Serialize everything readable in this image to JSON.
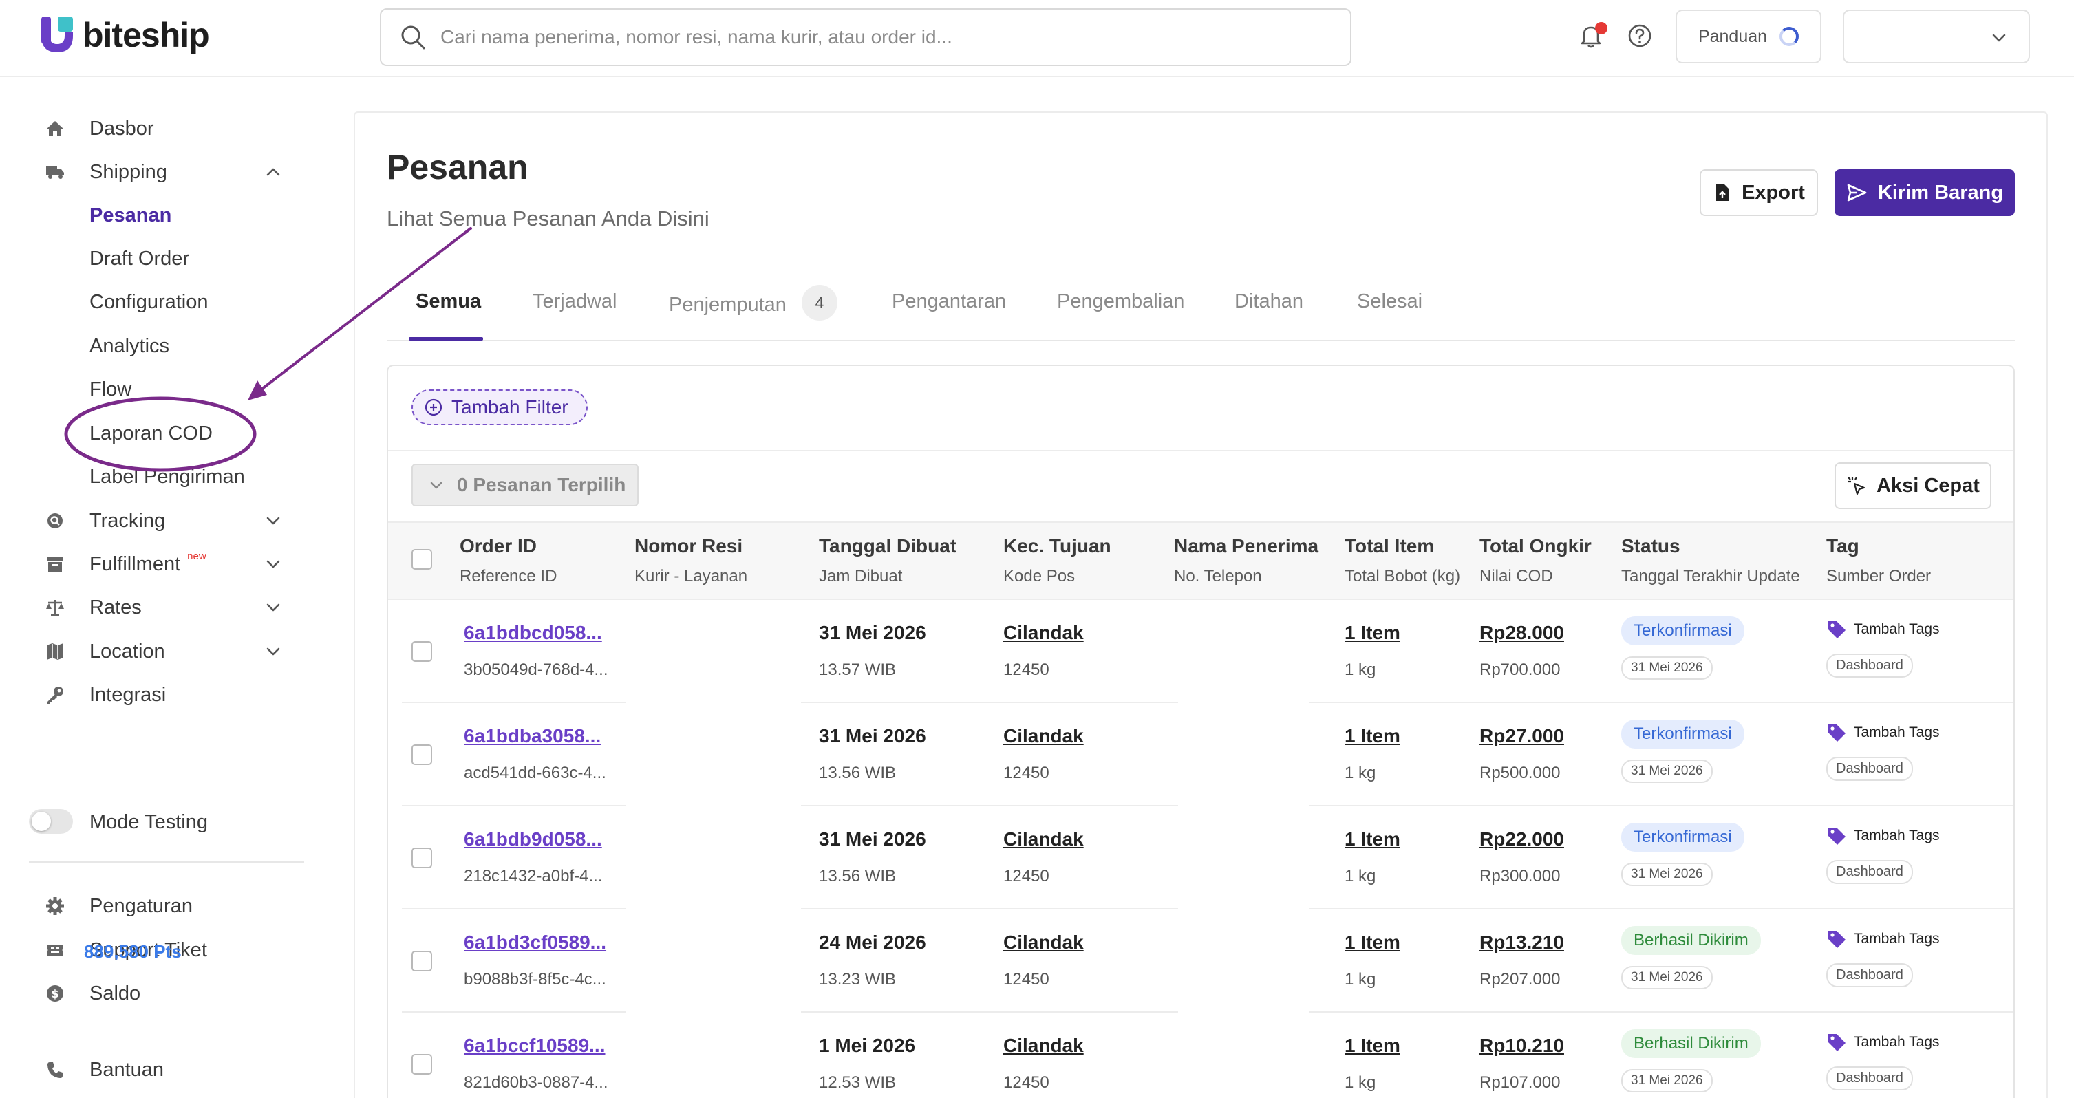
{
  "brand": {
    "name": "biteship",
    "accent": "#4b2ba3"
  },
  "search": {
    "placeholder": "Cari nama penerima, nomor resi, nama kurir, atau order id..."
  },
  "topbar": {
    "guide_label": "Panduan"
  },
  "sidebar": {
    "dashboard": "Dasbor",
    "shipping": "Shipping",
    "shipping_children": [
      "Pesanan",
      "Draft Order",
      "Configuration",
      "Analytics",
      "Flow",
      "Laporan COD",
      "Label Pengiriman"
    ],
    "tracking": "Tracking",
    "fulfillment": "Fulfillment",
    "fulfillment_badge": "new",
    "rates": "Rates",
    "location": "Location",
    "integration": "Integrasi",
    "mode_testing": "Mode Testing",
    "settings": "Pengaturan",
    "support": "Support Tiket",
    "balance": "Saldo",
    "balance_points": "889,580 Pts",
    "help": "Bantuan"
  },
  "page": {
    "title": "Pesanan",
    "subtitle": "Lihat Semua Pesanan Anda Disini",
    "export_label": "Export",
    "send_label": "Kirim Barang"
  },
  "tabs": [
    {
      "label": "Semua"
    },
    {
      "label": "Terjadwal"
    },
    {
      "label": "Penjemputan",
      "count": "4"
    },
    {
      "label": "Pengantaran"
    },
    {
      "label": "Pengembalian"
    },
    {
      "label": "Ditahan"
    },
    {
      "label": "Selesai"
    }
  ],
  "toolbar": {
    "add_filter": "Tambah Filter",
    "selected": "0 Pesanan Terpilih",
    "quick_action": "Aksi Cepat"
  },
  "columns": [
    {
      "title": "Order ID",
      "subtitle": "Reference ID"
    },
    {
      "title": "Nomor Resi",
      "subtitle": "Kurir - Layanan"
    },
    {
      "title": "Tanggal Dibuat",
      "subtitle": "Jam Dibuat"
    },
    {
      "title": "Kec. Tujuan",
      "subtitle": "Kode Pos"
    },
    {
      "title": "Nama Penerima",
      "subtitle": "No. Telepon"
    },
    {
      "title": "Total Item",
      "subtitle": "Total Bobot (kg)"
    },
    {
      "title": "Total Ongkir",
      "subtitle": "Nilai COD"
    },
    {
      "title": "Status",
      "subtitle": "Tanggal Terakhir Update"
    },
    {
      "title": "Tag",
      "subtitle": "Sumber Order"
    }
  ],
  "rows": [
    {
      "order_id": "6a1bdbcd058...",
      "ref_id": "3b05049d-768d-4...",
      "date": "31 Mei 2026",
      "time": "13.57 WIB",
      "district": "Cilandak",
      "postal": "12450",
      "items": "1 Item",
      "weight": "1 kg",
      "shipping": "Rp28.000",
      "cod": "Rp700.000",
      "status": "Terkonfirmasi",
      "status_color": "blue",
      "updated": "31 Mei 2026",
      "tag": "Tambah Tags",
      "source": "Dashboard"
    },
    {
      "order_id": "6a1bdba3058...",
      "ref_id": "acd541dd-663c-4...",
      "date": "31 Mei 2026",
      "time": "13.56 WIB",
      "district": "Cilandak",
      "postal": "12450",
      "items": "1 Item",
      "weight": "1 kg",
      "shipping": "Rp27.000",
      "cod": "Rp500.000",
      "status": "Terkonfirmasi",
      "status_color": "blue",
      "updated": "31 Mei 2026",
      "tag": "Tambah Tags",
      "source": "Dashboard"
    },
    {
      "order_id": "6a1bdb9d058...",
      "ref_id": "218c1432-a0bf-4...",
      "date": "31 Mei 2026",
      "time": "13.56 WIB",
      "district": "Cilandak",
      "postal": "12450",
      "items": "1 Item",
      "weight": "1 kg",
      "shipping": "Rp22.000",
      "cod": "Rp300.000",
      "status": "Terkonfirmasi",
      "status_color": "blue",
      "updated": "31 Mei 2026",
      "tag": "Tambah Tags",
      "source": "Dashboard"
    },
    {
      "order_id": "6a1bd3cf0589...",
      "ref_id": "b9088b3f-8f5c-4c...",
      "date": "24 Mei 2026",
      "time": "13.23 WIB",
      "district": "Cilandak",
      "postal": "12450",
      "items": "1 Item",
      "weight": "1 kg",
      "shipping": "Rp13.210",
      "cod": "Rp207.000",
      "status": "Berhasil Dikirim",
      "status_color": "green",
      "updated": "31 Mei 2026",
      "tag": "Tambah Tags",
      "source": "Dashboard"
    },
    {
      "order_id": "6a1bccf10589...",
      "ref_id": "821d60b3-0887-4...",
      "date": "1 Mei 2026",
      "time": "12.53 WIB",
      "district": "Cilandak",
      "postal": "12450",
      "items": "1 Item",
      "weight": "1 kg",
      "shipping": "Rp10.210",
      "cod": "Rp107.000",
      "status": "Berhasil Dikirim",
      "status_color": "green",
      "updated": "31 Mei 2026",
      "tag": "Tambah Tags",
      "source": "Dashboard"
    }
  ]
}
